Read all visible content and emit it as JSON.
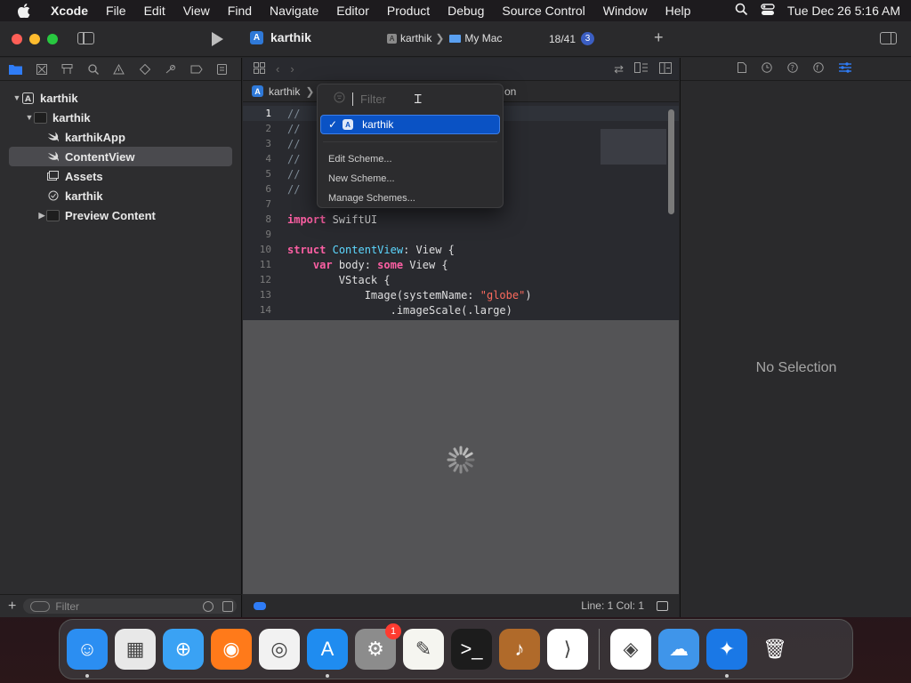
{
  "menubar": {
    "app": "Xcode",
    "items": [
      "File",
      "Edit",
      "View",
      "Find",
      "Navigate",
      "Editor",
      "Product",
      "Debug",
      "Source Control",
      "Window",
      "Help"
    ],
    "clock": "Tue Dec 26  5:16 AM"
  },
  "toolbar": {
    "project_title": "karthik",
    "scheme": "karthik",
    "destination": "My Mac",
    "counter": "18/41",
    "badge": "3"
  },
  "navigator": {
    "tree": [
      {
        "label": "karthik",
        "indent": 0,
        "icon": "xcode-project-icon",
        "disclosure": "▼"
      },
      {
        "label": "karthik",
        "indent": 1,
        "icon": "folder-icon",
        "disclosure": "▼"
      },
      {
        "label": "karthikApp",
        "indent": 2,
        "icon": "swift-file-icon",
        "disclosure": ""
      },
      {
        "label": "ContentView",
        "indent": 2,
        "icon": "swift-file-icon",
        "disclosure": "",
        "selected": true
      },
      {
        "label": "Assets",
        "indent": 2,
        "icon": "assets-icon",
        "disclosure": ""
      },
      {
        "label": "karthik",
        "indent": 2,
        "icon": "entitlements-icon",
        "disclosure": ""
      },
      {
        "label": "Preview Content",
        "indent": 2,
        "icon": "folder-icon",
        "disclosure": "▶"
      }
    ],
    "filter_placeholder": "Filter"
  },
  "editor": {
    "breadcrumb_project": "karthik",
    "breadcrumb_tail": "on",
    "lines": [
      {
        "n": "1",
        "html": "<span class='cm'>//</span>"
      },
      {
        "n": "2",
        "html": "<span class='cm'>//</span>"
      },
      {
        "n": "3",
        "html": "<span class='cm'>//</span>"
      },
      {
        "n": "4",
        "html": "<span class='cm'>//</span>"
      },
      {
        "n": "5",
        "html": "<span class='cm'>//</span>"
      },
      {
        "n": "6",
        "html": "<span class='cm'>//</span>"
      },
      {
        "n": "7",
        "html": ""
      },
      {
        "n": "8",
        "html": "<span class='kw'>import</span><span class='pl'> SwiftUI</span>"
      },
      {
        "n": "9",
        "html": ""
      },
      {
        "n": "10",
        "html": "<span class='kw'>struct</span><span class='pl'> </span><span class='ty'>ContentView</span><span class='pl'>: View {</span>"
      },
      {
        "n": "11",
        "html": "<span class='pl'>    </span><span class='kw'>var</span><span class='pl'> body: </span><span class='kw'>some</span><span class='pl'> View {</span>"
      },
      {
        "n": "12",
        "html": "<span class='pl'>        VStack {</span>"
      },
      {
        "n": "13",
        "html": "<span class='pl'>            Image(systemName: </span><span class='st'>\"globe\"</span><span class='pl'>)</span>"
      },
      {
        "n": "14",
        "html": "<span class='pl'>                .imageScale(.large)</span>"
      }
    ],
    "status": "Line: 1  Col: 1"
  },
  "inspector": {
    "empty_text": "No Selection"
  },
  "scheme_menu": {
    "filter_placeholder": "Filter",
    "selected_scheme": "karthik",
    "items": [
      "Edit Scheme...",
      "New Scheme...",
      "Manage Schemes..."
    ]
  },
  "dock": {
    "apps": [
      {
        "name": "Finder",
        "icon": "finder-icon",
        "bg": "#2b8ef2",
        "glyph": "☺",
        "running": true
      },
      {
        "name": "Launchpad",
        "icon": "launchpad-icon",
        "bg": "#e8e8e8",
        "glyph": "▦",
        "running": false
      },
      {
        "name": "Safari",
        "icon": "safari-icon",
        "bg": "#3aa2f4",
        "glyph": "⊕",
        "running": false
      },
      {
        "name": "Firefox",
        "icon": "firefox-icon",
        "bg": "#ff7a1a",
        "glyph": "◉",
        "running": false
      },
      {
        "name": "Chrome",
        "icon": "chrome-icon",
        "bg": "#f2f2f2",
        "glyph": "◎",
        "running": false
      },
      {
        "name": "App Store",
        "icon": "app-store-icon",
        "bg": "#1f8cf0",
        "glyph": "A",
        "running": true
      },
      {
        "name": "System Settings",
        "icon": "system-settings-icon",
        "bg": "#8c8c8c",
        "glyph": "⚙",
        "running": false,
        "badge": "1"
      },
      {
        "name": "TextEdit",
        "icon": "textedit-icon",
        "bg": "#f5f5f0",
        "glyph": "✎",
        "running": false
      },
      {
        "name": "Terminal",
        "icon": "terminal-icon",
        "bg": "#1c1c1c",
        "glyph": ">_",
        "running": false
      },
      {
        "name": "Instruments",
        "icon": "instruments-icon",
        "bg": "#b06a2a",
        "glyph": "♪",
        "running": false
      },
      {
        "name": "Visual Studio Code",
        "icon": "vscode-icon",
        "bg": "#ffffff",
        "glyph": "⟩",
        "running": false
      }
    ],
    "right_apps": [
      {
        "name": "Visual Studio",
        "icon": "visual-studio-icon",
        "bg": "#ffffff",
        "glyph": "◈",
        "running": false
      },
      {
        "name": "Weather",
        "icon": "weather-icon",
        "bg": "#3f95ea",
        "glyph": "☁",
        "running": false
      },
      {
        "name": "Xcode",
        "icon": "xcode-icon",
        "bg": "#1a78e6",
        "glyph": "✦",
        "running": true
      },
      {
        "name": "Trash",
        "icon": "trash-icon",
        "bg": "transparent",
        "glyph": "🗑",
        "running": false
      }
    ]
  }
}
